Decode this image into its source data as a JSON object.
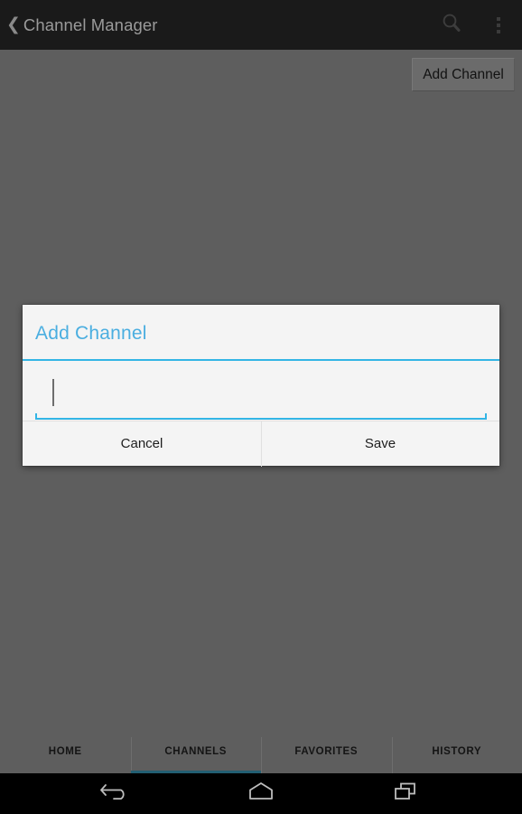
{
  "appbar": {
    "back_icon": "back-chevron-icon",
    "title": "Channel Manager",
    "search_icon": "search-icon",
    "overflow_icon": "overflow-menu-icon"
  },
  "content": {
    "add_channel_label": "Add Channel"
  },
  "dialog": {
    "title": "Add Channel",
    "input_value": "",
    "input_placeholder": "",
    "cancel_label": "Cancel",
    "save_label": "Save"
  },
  "tabs": [
    {
      "label": "HOME",
      "active": false
    },
    {
      "label": "CHANNELS",
      "active": true
    },
    {
      "label": "FAVORITES",
      "active": false
    },
    {
      "label": "HISTORY",
      "active": false
    }
  ],
  "navbar": {
    "back_icon": "system-back-icon",
    "home_icon": "system-home-icon",
    "recents_icon": "system-recents-icon"
  },
  "colors": {
    "accent_blue": "#33b5e5",
    "title_blue": "#4aaee0",
    "appbar_black": "#1a1a1a",
    "scrim_gray": "#5e5e5e",
    "dialog_bg": "#f4f4f4",
    "tab_indicator": "#235f73"
  }
}
